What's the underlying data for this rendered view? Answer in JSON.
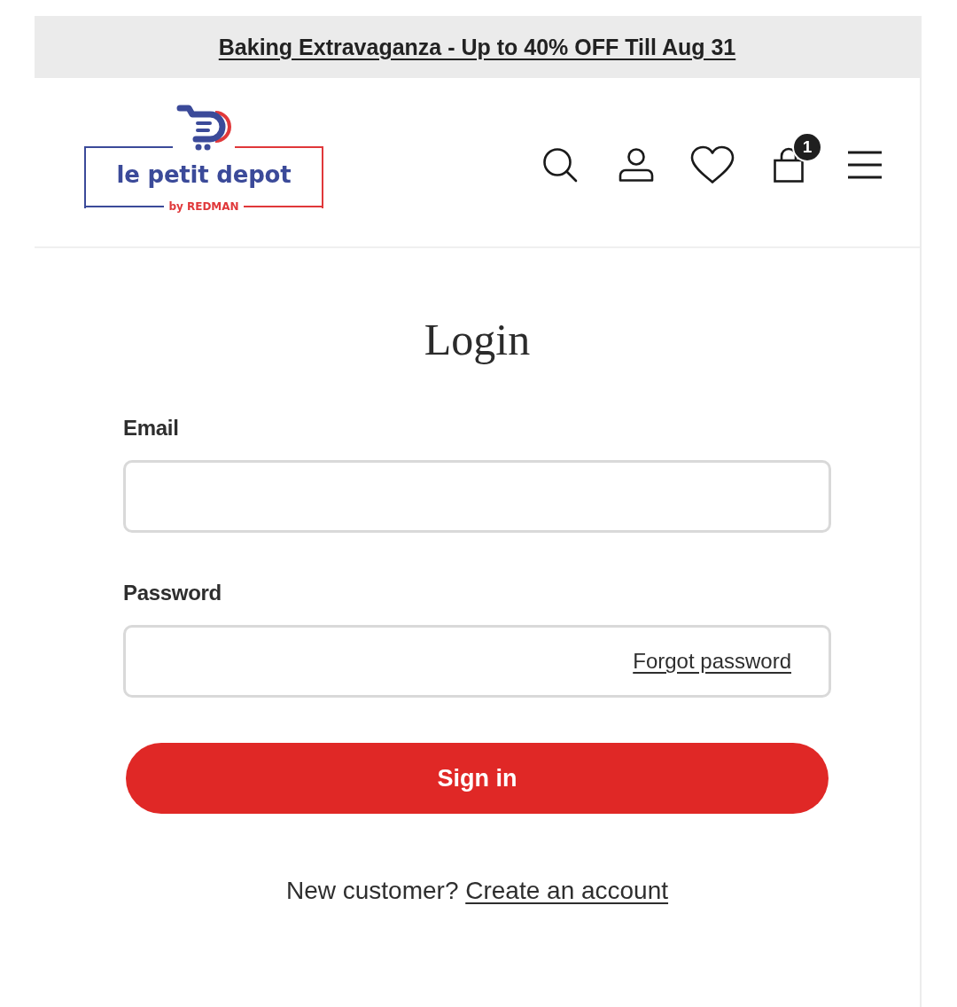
{
  "announcement": {
    "text": "Baking Extravaganza - Up to 40% OFF Till Aug 31"
  },
  "logo": {
    "name": "le petit depot",
    "tagline": "by REDMAN"
  },
  "cart": {
    "count": "1"
  },
  "login": {
    "title": "Login",
    "fields": [
      {
        "label": "Email"
      },
      {
        "label": "Password",
        "link": "Forgot password"
      }
    ],
    "submit": "Sign in",
    "signup": {
      "prompt": "New customer?",
      "link": "Create an account"
    }
  }
}
